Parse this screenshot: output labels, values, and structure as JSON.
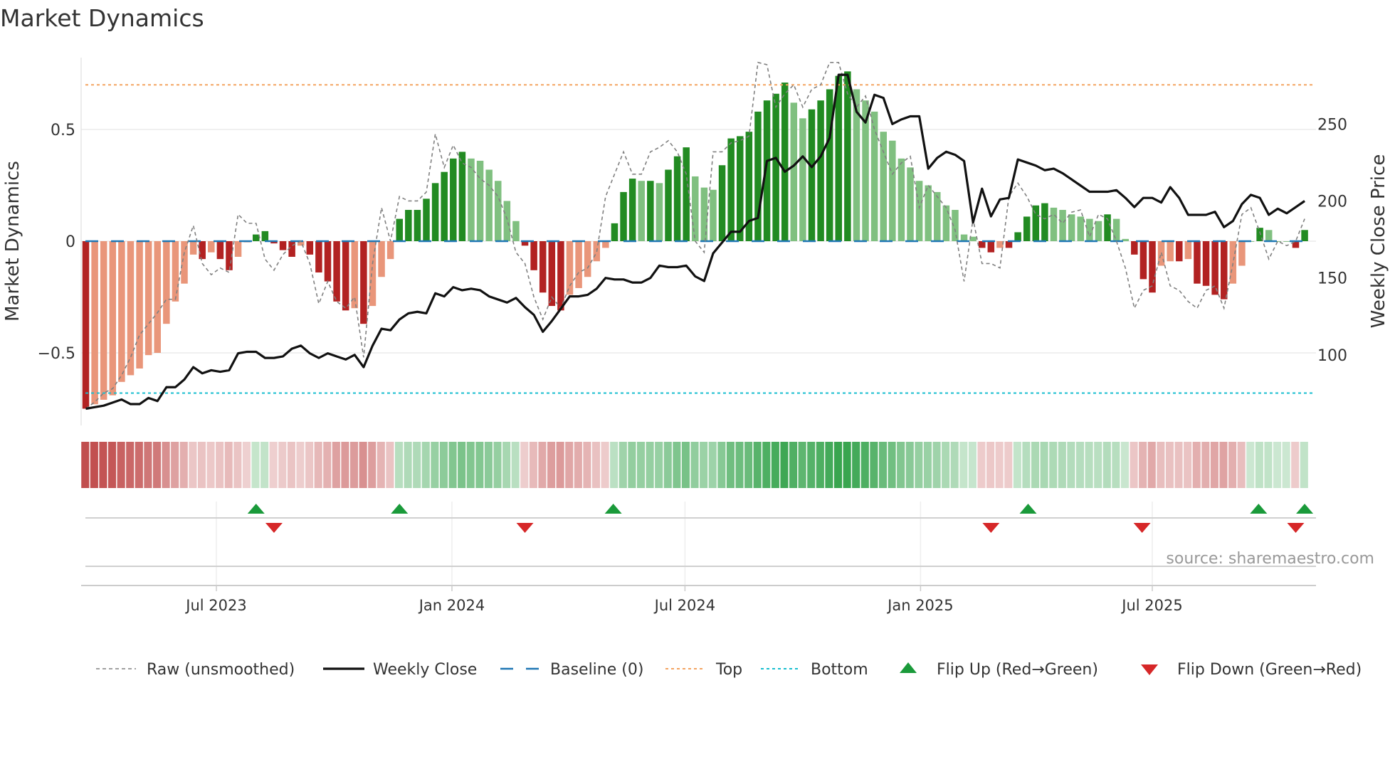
{
  "title": "Market Dynamics",
  "source": "source: sharemaestro.com",
  "chart_data": {
    "type": "bar",
    "title": "Market Dynamics",
    "ylabel": "Market Dynamics",
    "ylabel_right": "Weekly Close Price",
    "ylim": [
      -0.75,
      0.82
    ],
    "ylim_right": [
      62,
      298
    ],
    "yticks": [
      {
        "v": 0.5,
        "label": "0.5"
      },
      {
        "v": 0,
        "label": "0"
      },
      {
        "v": -0.5,
        "label": "−0.5"
      }
    ],
    "yticks_right": [
      {
        "v": 250,
        "label": "250"
      },
      {
        "v": 200,
        "label": "200"
      },
      {
        "v": 150,
        "label": "150"
      },
      {
        "v": 100,
        "label": "100"
      }
    ],
    "xticks": [
      {
        "date": "2023-07-01",
        "label": "Jul 2023"
      },
      {
        "date": "2024-01-01",
        "label": "Jan 2024"
      },
      {
        "date": "2024-07-01",
        "label": "Jul 2024"
      },
      {
        "date": "2025-01-01",
        "label": "Jan 2025"
      },
      {
        "date": "2025-07-01",
        "label": "Jul 2025"
      }
    ],
    "start_date": "2023-03-21",
    "frequency": "weekly",
    "top_level": 0.7,
    "bottom_level": -0.68,
    "baseline": 0,
    "colors": {
      "strong_red": "#b22222",
      "weak_red": "#e9967a",
      "strong_green": "#228b22",
      "weak_green": "#80c080",
      "close": "#111111",
      "raw": "#808080",
      "baseline": "#1f77b4",
      "top": "#f4a460",
      "bottom": "#17becf",
      "flip_up": "#1a9a3a",
      "flip_down": "#d62728"
    },
    "dynamics": [
      -0.75,
      -0.73,
      -0.71,
      -0.69,
      -0.63,
      -0.6,
      -0.57,
      -0.51,
      -0.5,
      -0.37,
      -0.27,
      -0.19,
      -0.06,
      -0.08,
      -0.05,
      -0.08,
      -0.13,
      -0.07,
      -0.005,
      0.03,
      0.045,
      -0.01,
      -0.04,
      -0.07,
      -0.02,
      -0.06,
      -0.14,
      -0.18,
      -0.27,
      -0.31,
      -0.3,
      -0.37,
      -0.29,
      -0.16,
      -0.08,
      0.1,
      0.14,
      0.14,
      0.19,
      0.26,
      0.31,
      0.37,
      0.4,
      0.37,
      0.36,
      0.32,
      0.27,
      0.18,
      0.09,
      -0.02,
      -0.13,
      -0.23,
      -0.29,
      -0.31,
      -0.24,
      -0.21,
      -0.16,
      -0.09,
      -0.03,
      0.08,
      0.22,
      0.28,
      0.27,
      0.27,
      0.26,
      0.32,
      0.38,
      0.42,
      0.29,
      0.24,
      0.23,
      0.34,
      0.46,
      0.47,
      0.49,
      0.58,
      0.63,
      0.66,
      0.71,
      0.62,
      0.55,
      0.59,
      0.63,
      0.68,
      0.74,
      0.76,
      0.68,
      0.63,
      0.58,
      0.49,
      0.45,
      0.37,
      0.33,
      0.27,
      0.25,
      0.22,
      0.16,
      0.14,
      0.03,
      0.02,
      -0.03,
      -0.05,
      -0.03,
      -0.03,
      0.04,
      0.11,
      0.16,
      0.17,
      0.15,
      0.14,
      0.12,
      0.11,
      0.1,
      0.09,
      0.12,
      0.1,
      0.01,
      -0.06,
      -0.17,
      -0.23,
      -0.11,
      -0.09,
      -0.09,
      -0.08,
      -0.19,
      -0.2,
      -0.24,
      -0.26,
      -0.19,
      -0.11,
      0.0,
      0.06,
      0.05,
      0.0,
      0.0,
      -0.03,
      0.05
    ],
    "raw": [
      -0.75,
      -0.72,
      -0.68,
      -0.66,
      -0.6,
      -0.52,
      -0.42,
      -0.37,
      -0.32,
      -0.26,
      -0.26,
      -0.05,
      0.07,
      -0.1,
      -0.15,
      -0.12,
      -0.14,
      0.12,
      0.08,
      0.08,
      -0.08,
      -0.13,
      -0.06,
      -0.02,
      0.0,
      -0.1,
      -0.28,
      -0.18,
      -0.27,
      -0.3,
      -0.25,
      -0.52,
      -0.1,
      0.15,
      0.0,
      0.2,
      0.18,
      0.18,
      0.22,
      0.48,
      0.33,
      0.43,
      0.35,
      0.33,
      0.28,
      0.25,
      0.2,
      0.1,
      -0.05,
      -0.1,
      -0.25,
      -0.35,
      -0.25,
      -0.3,
      -0.2,
      -0.14,
      -0.12,
      -0.05,
      0.2,
      0.3,
      0.4,
      0.3,
      0.3,
      0.4,
      0.42,
      0.45,
      0.4,
      0.3,
      0.0,
      -0.05,
      0.4,
      0.4,
      0.44,
      0.45,
      0.47,
      0.8,
      0.79,
      0.6,
      0.66,
      0.7,
      0.6,
      0.68,
      0.7,
      0.8,
      0.8,
      0.66,
      0.6,
      0.65,
      0.5,
      0.4,
      0.3,
      0.35,
      0.38,
      0.15,
      0.25,
      0.2,
      0.15,
      0.05,
      -0.18,
      0.1,
      -0.1,
      -0.1,
      -0.12,
      0.2,
      0.26,
      0.2,
      0.12,
      0.1,
      0.12,
      0.08,
      0.13,
      0.14,
      0.02,
      0.12,
      0.1,
      0.0,
      -0.12,
      -0.3,
      -0.22,
      -0.2,
      -0.05,
      -0.2,
      -0.22,
      -0.27,
      -0.3,
      -0.22,
      -0.2,
      -0.3,
      -0.1,
      0.12,
      0.15,
      0.04,
      -0.08,
      0.0,
      -0.02,
      0.0,
      0.1
    ],
    "weekly_close": [
      65,
      66,
      67,
      69,
      71,
      68,
      68,
      72,
      70,
      79,
      79,
      84,
      92,
      88,
      90,
      89,
      90,
      101,
      102,
      102,
      98,
      98,
      99,
      104,
      106,
      101,
      98,
      101,
      99,
      97,
      100,
      92,
      106,
      117,
      116,
      123,
      127,
      128,
      127,
      140,
      138,
      144,
      142,
      143,
      142,
      138,
      136,
      134,
      137,
      131,
      126,
      115,
      122,
      130,
      138,
      138,
      139,
      143,
      150,
      149,
      149,
      147,
      147,
      150,
      158,
      157,
      157,
      158,
      151,
      148,
      166,
      173,
      180,
      180,
      187,
      189,
      226,
      228,
      219,
      223,
      229,
      222,
      229,
      241,
      282,
      282,
      258,
      251,
      269,
      267,
      250,
      253,
      255,
      255,
      221,
      228,
      232,
      230,
      226,
      186,
      208,
      190,
      201,
      202,
      227,
      225,
      223,
      220,
      221,
      218,
      214,
      210,
      206,
      206,
      206,
      207,
      202,
      196,
      202,
      202,
      199,
      209,
      202,
      191,
      191,
      191,
      193,
      183,
      187,
      198,
      204,
      202,
      191,
      195,
      192,
      196,
      200
    ],
    "flip_up": [
      "2023-08-01",
      "2023-11-21",
      "2024-05-06",
      "2025-03-26",
      "2025-09-22",
      "2025-10-28"
    ],
    "flip_down": [
      "2023-08-15",
      "2024-02-27",
      "2025-02-25",
      "2025-06-23",
      "2025-10-21"
    ],
    "legend": {
      "position": "bottom",
      "items": [
        {
          "key": "raw",
          "label": "Raw (unsmoothed)"
        },
        {
          "key": "close",
          "label": "Weekly Close"
        },
        {
          "key": "baseline",
          "label": "Baseline (0)"
        },
        {
          "key": "top",
          "label": "Top"
        },
        {
          "key": "bottom",
          "label": "Bottom"
        },
        {
          "key": "flip_up",
          "label": "Flip Up (Red→Green)"
        },
        {
          "key": "flip_down",
          "label": "Flip Down (Green→Red)"
        }
      ]
    }
  }
}
